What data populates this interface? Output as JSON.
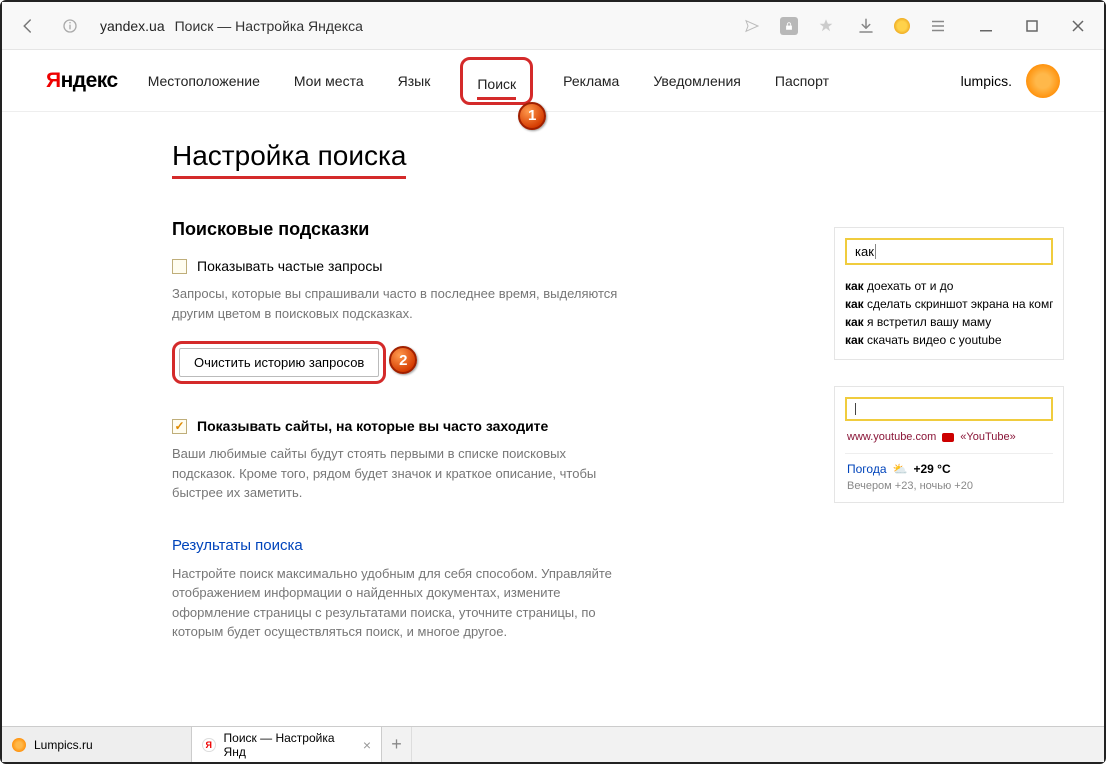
{
  "toolbar": {
    "domain": "yandex.ua",
    "title": "Поиск — Настройка Яндекса"
  },
  "header": {
    "logo_prefix": "Я",
    "logo_rest": "ндекс",
    "nav": [
      "Местоположение",
      "Мои места",
      "Язык",
      "Поиск",
      "Реклама",
      "Уведомления",
      "Паспорт"
    ],
    "user": "lumpics."
  },
  "badges": {
    "one": "1",
    "two": "2"
  },
  "page": {
    "title": "Настройка поиска",
    "hints_heading": "Поисковые подсказки",
    "chk_frequent_label": "Показывать частые запросы",
    "frequent_desc": "Запросы, которые вы спрашивали часто в последнее время, выделяются другим цветом в поисковых подсказках.",
    "clear_btn": "Очистить историю запросов",
    "chk_sites_label": "Показывать сайты, на которые вы часто заходите",
    "sites_desc": "Ваши любимые сайты будут стоять первыми в списке поисковых подсказок. Кроме того, рядом будет значок и краткое описание, чтобы быстрее их заметить.",
    "results_heading": "Результаты поиска",
    "results_desc": "Настройте поиск максимально удобным для себя способом. Управляйте отображением информации о найденных документах, измените оформление страницы с результатами поиска, уточните страницы, по которым будет осуществляться поиск, и многое другое."
  },
  "preview1": {
    "query": "как",
    "suggestions": [
      {
        "bold": "как",
        "rest": " доехать от и до"
      },
      {
        "bold": "как",
        "rest": " сделать скриншот экрана на компь"
      },
      {
        "bold": "как",
        "rest": " я встретил вашу маму"
      },
      {
        "bold": "как",
        "rest": " скачать видео с youtube"
      }
    ]
  },
  "preview2": {
    "url": "www.youtube.com",
    "url_title": "«YouTube»",
    "weather_label": "Погода",
    "temp": "+29 °C",
    "later": "Вечером +23,  ночью +20"
  },
  "tabs": {
    "t1": "Lumpics.ru",
    "t2": "Поиск — Настройка Янд"
  }
}
